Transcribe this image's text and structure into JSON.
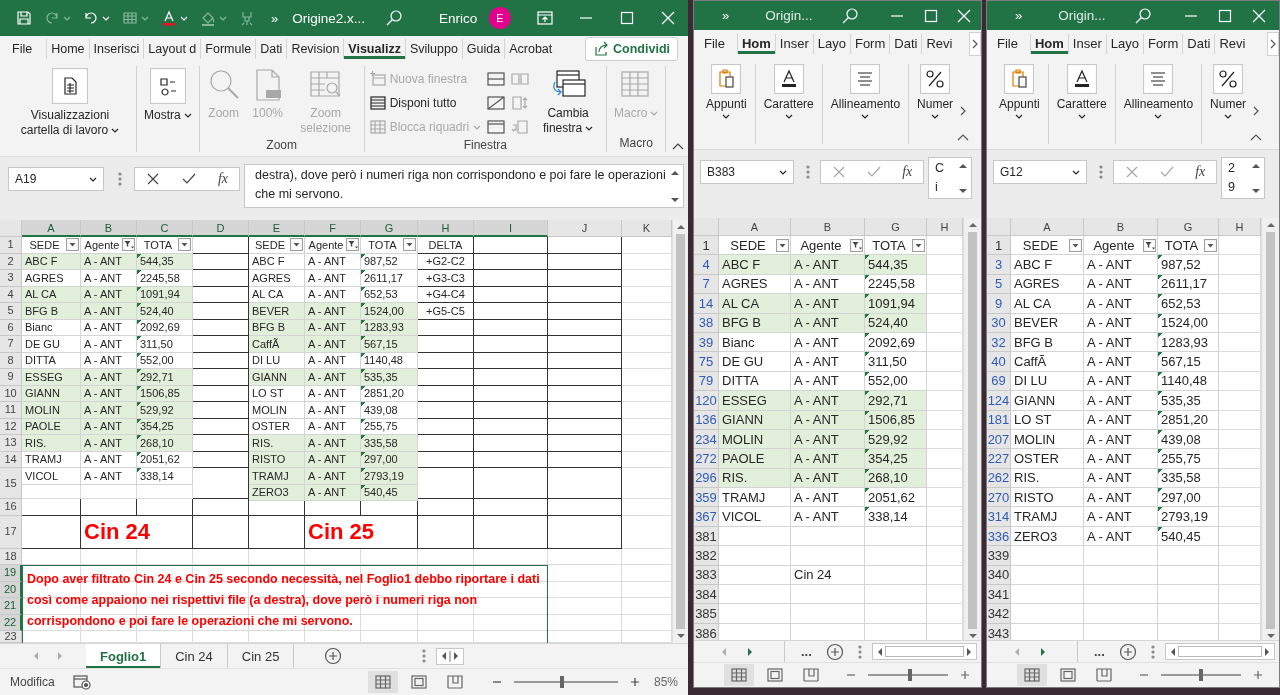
{
  "main_window": {
    "quick_access": [
      {
        "kind": "save",
        "disabled": false
      },
      {
        "kind": "redo",
        "disabled": true,
        "dropdown": true
      },
      {
        "kind": "undo",
        "disabled": false,
        "dropdown": true
      },
      {
        "kind": "table",
        "disabled": true,
        "dropdown": true
      },
      {
        "kind": "font-color",
        "disabled": false,
        "dropdown": true
      },
      {
        "kind": "fill",
        "disabled": true,
        "dropdown": true
      },
      {
        "kind": "clear",
        "disabled": true
      }
    ],
    "overflow": "»",
    "title": "Origine2.x...",
    "user": "Enrico",
    "avatar": "E",
    "tabs": [
      {
        "label": "File",
        "selected": false
      },
      {
        "label": "Home",
        "selected": false
      },
      {
        "label": "Inserisci",
        "selected": false
      },
      {
        "label": "Layout d",
        "selected": false
      },
      {
        "label": "Formule",
        "selected": false
      },
      {
        "label": "Dati",
        "selected": false
      },
      {
        "label": "Revision",
        "selected": false
      },
      {
        "label": "Visualizz",
        "selected": true
      },
      {
        "label": "Sviluppo",
        "selected": false
      },
      {
        "label": "Guida",
        "selected": false
      },
      {
        "label": "Acrobat",
        "selected": false
      }
    ],
    "share_button": "Condividi",
    "ribbon_groups": [
      {
        "commands": [
          {
            "label": "Visualizzazioni cartella di lavoro",
            "kind": "large",
            "disabled": false,
            "dropdown": true
          }
        ]
      },
      {
        "commands": [
          {
            "label": "Mostra",
            "kind": "large",
            "disabled": false,
            "dropdown": true
          }
        ]
      },
      {
        "label": "Zoom",
        "commands": [
          {
            "label": "Zoom",
            "kind": "large",
            "disabled": true,
            "dropdown": false
          },
          {
            "label": "100%",
            "kind": "large",
            "disabled": true,
            "dropdown": false
          },
          {
            "label": "Zoom selezione",
            "kind": "large",
            "disabled": true,
            "dropdown": false
          }
        ]
      },
      {
        "label": "Finestra",
        "commands": [
          {
            "label": "Nuova finestra",
            "kind": "small",
            "disabled": true,
            "dropdown": false
          },
          {
            "label": "Disponi tutto",
            "kind": "small",
            "disabled": false,
            "dropdown": false
          },
          {
            "label": "Blocca riquadri",
            "kind": "small",
            "disabled": true,
            "dropdown": true
          },
          {
            "kind": "icon",
            "disabled": false
          },
          {
            "kind": "icon",
            "disabled": false
          },
          {
            "kind": "icon",
            "disabled": false
          },
          {
            "kind": "icon",
            "disabled": true
          },
          {
            "kind": "icon",
            "disabled": true
          },
          {
            "kind": "icon",
            "disabled": true
          },
          {
            "label": "Cambia finestra",
            "kind": "large",
            "disabled": false,
            "dropdown": true
          }
        ]
      },
      {
        "label": "Macro",
        "commands": [
          {
            "label": "Macro",
            "kind": "large",
            "disabled": true,
            "dropdown": true
          }
        ]
      }
    ],
    "name_box": "A19",
    "fx": "fx",
    "formula": "destra), dove però i numeri riga non corrispondono e poi fare le operazioni che mi servono.",
    "sheet": {
      "columns": [
        {
          "label": "A",
          "selected": true
        },
        {
          "label": "B",
          "selected": true
        },
        {
          "label": "C",
          "selected": true
        },
        {
          "label": "D",
          "selected": true
        },
        {
          "label": "E",
          "selected": true
        },
        {
          "label": "F",
          "selected": true
        },
        {
          "label": "G",
          "selected": true
        },
        {
          "label": "H",
          "selected": true
        },
        {
          "label": "I",
          "selected": true
        },
        {
          "label": "J",
          "selected": false
        },
        {
          "label": "K",
          "selected": false
        }
      ],
      "rows": [
        {
          "label": "1",
          "selected": false
        },
        {
          "label": "2",
          "selected": false
        },
        {
          "label": "3",
          "selected": false
        },
        {
          "label": "4",
          "selected": false
        },
        {
          "label": "5",
          "selected": false
        },
        {
          "label": "6",
          "selected": false
        },
        {
          "label": "7",
          "selected": false
        },
        {
          "label": "8",
          "selected": false
        },
        {
          "label": "9",
          "selected": false
        },
        {
          "label": "10",
          "selected": false
        },
        {
          "label": "11",
          "selected": false
        },
        {
          "label": "12",
          "selected": false
        },
        {
          "label": "13",
          "selected": false
        },
        {
          "label": "14",
          "selected": false
        },
        {
          "label": "15",
          "selected": false
        },
        {
          "label": "16",
          "selected": false
        },
        {
          "label": "17",
          "selected": false
        },
        {
          "label": "18",
          "selected": false
        },
        {
          "label": "19",
          "selected": true
        },
        {
          "label": "20",
          "selected": true
        },
        {
          "label": "21",
          "selected": true
        },
        {
          "label": "22",
          "selected": true
        },
        {
          "label": "23",
          "selected": false
        }
      ],
      "blocks": [
        {
          "header": [
            {
              "label": "SEDE",
              "filtered": false
            },
            {
              "label": "Agente",
              "filtered": true
            },
            {
              "label": "TOTA",
              "filtered": false
            }
          ],
          "rows": [
            {
              "cells": [
                "ABC F",
                "A - ANT",
                "544,35"
              ],
              "highlighted": true
            },
            {
              "cells": [
                "AGRES",
                "A - ANT",
                "2245,58"
              ],
              "highlighted": false
            },
            {
              "cells": [
                "AL CA",
                "A - ANT",
                "1091,94"
              ],
              "highlighted": true
            },
            {
              "cells": [
                "BFG B",
                "A - ANT",
                "524,40"
              ],
              "highlighted": true
            },
            {
              "cells": [
                "Bianc",
                "A - ANT",
                "2092,69"
              ],
              "highlighted": false
            },
            {
              "cells": [
                "DE GU",
                "A - ANT",
                "311,50"
              ],
              "highlighted": false
            },
            {
              "cells": [
                "DITTA",
                "A - ANT",
                "552,00"
              ],
              "highlighted": false
            },
            {
              "cells": [
                "ESSEG",
                "A - ANT",
                "292,71"
              ],
              "highlighted": true
            },
            {
              "cells": [
                "GIANN",
                "A - ANT",
                "1506,85"
              ],
              "highlighted": true
            },
            {
              "cells": [
                "MOLIN",
                "A - ANT",
                "529,92"
              ],
              "highlighted": true
            },
            {
              "cells": [
                "PAOLE",
                "A - ANT",
                "354,25"
              ],
              "highlighted": true
            },
            {
              "cells": [
                "RIS.",
                "A - ANT",
                "268,10"
              ],
              "highlighted": true
            },
            {
              "cells": [
                "TRAMJ",
                "A - ANT",
                "2051,62"
              ],
              "highlighted": false
            },
            {
              "cells": [
                "VICOL",
                "A - ANT",
                "338,14"
              ],
              "highlighted": false
            }
          ]
        },
        {
          "header": [
            {
              "label": "SEDE",
              "filtered": false
            },
            {
              "label": "Agente",
              "filtered": true
            },
            {
              "label": "TOTA",
              "filtered": false
            }
          ],
          "rows": [
            {
              "cells": [
                "ABC F",
                "A - ANT",
                "987,52"
              ],
              "highlighted": false
            },
            {
              "cells": [
                "AGRES",
                "A - ANT",
                "2611,17"
              ],
              "highlighted": false
            },
            {
              "cells": [
                "AL CA",
                "A - ANT",
                "652,53"
              ],
              "highlighted": false
            },
            {
              "cells": [
                "BEVER",
                "A - ANT",
                "1524,00"
              ],
              "highlighted": true
            },
            {
              "cells": [
                "BFG B",
                "A - ANT",
                "1283,93"
              ],
              "highlighted": true
            },
            {
              "cells": [
                "CaffÃ",
                "A - ANT",
                "567,15"
              ],
              "highlighted": true
            },
            {
              "cells": [
                "DI LU",
                "A - ANT",
                "1140,48"
              ],
              "highlighted": false
            },
            {
              "cells": [
                "GIANN",
                "A - ANT",
                "535,35"
              ],
              "highlighted": true
            },
            {
              "cells": [
                "LO ST",
                "A - ANT",
                "2851,20"
              ],
              "highlighted": false
            },
            {
              "cells": [
                "MOLIN",
                "A - ANT",
                "439,08"
              ],
              "highlighted": false
            },
            {
              "cells": [
                "OSTER",
                "A - ANT",
                "255,75"
              ],
              "highlighted": false
            },
            {
              "cells": [
                "RIS.",
                "A - ANT",
                "335,58"
              ],
              "highlighted": true
            },
            {
              "cells": [
                "RISTO",
                "A - ANT",
                "297,00"
              ],
              "highlighted": true
            },
            {
              "cells": [
                "TRAMJ",
                "A - ANT",
                "2793,19"
              ],
              "highlighted": true
            },
            {
              "cells": [
                "ZERO3",
                "A - ANT",
                "540,45"
              ],
              "highlighted": true
            }
          ]
        }
      ],
      "delta": {
        "header": "DELTA",
        "formulas": [
          "+G2-C2",
          "+G3-C3",
          "+G4-C4",
          "+G5-C5"
        ]
      },
      "captions": [
        "Cin 24",
        "Cin 25"
      ],
      "note": "Dopo aver filtrato Cin 24 e Cin 25 secondo necessità, nel Foglio1 debbo riportare i dati così come appaiono nei rispettivi file (a destra), dove però i numeri riga non corrispondono e poi fare le operazioni che mi servono."
    },
    "sheet_tabs": [
      {
        "label": "Foglio1",
        "selected": true
      },
      {
        "label": "Cin 24",
        "selected": false
      },
      {
        "label": "Cin 25",
        "selected": false
      }
    ],
    "status": "Modifica",
    "zoom_slider": {
      "level": 0.46
    },
    "zoom": "85%"
  },
  "side_windows": [
    {
      "overflow": "»",
      "title": "Origin...",
      "tabs": [
        {
          "label": "File",
          "selected": false
        },
        {
          "label": "Hom",
          "selected": true
        },
        {
          "label": "Inser",
          "selected": false
        },
        {
          "label": "Layo",
          "selected": false
        },
        {
          "label": "Form",
          "selected": false
        },
        {
          "label": "Dati",
          "selected": false
        },
        {
          "label": "Revi",
          "selected": false
        }
      ],
      "ribbon_groups": [
        "Appunti",
        "Carattere",
        "Allineamento",
        "Numer"
      ],
      "name_box": "B383",
      "fx": "fx",
      "formula_lines": [
        "C",
        "i"
      ],
      "columns": [
        "A",
        "B",
        "G",
        "H"
      ],
      "header_row": "1",
      "header": [
        {
          "label": "SEDE",
          "filtered": false
        },
        {
          "label": "Agente",
          "filtered": true
        },
        {
          "label": "TOTA",
          "filtered": false
        }
      ],
      "rows": [
        {
          "number": "4",
          "filtered": true,
          "highlighted": true,
          "cells": {
            "A": "ABC F",
            "B": "A - ANT",
            "G": "544,35"
          }
        },
        {
          "number": "7",
          "filtered": true,
          "highlighted": false,
          "cells": {
            "A": "AGRES",
            "B": "A - ANT",
            "G": "2245,58"
          }
        },
        {
          "number": "14",
          "filtered": true,
          "highlighted": true,
          "cells": {
            "A": "AL CA",
            "B": "A - ANT",
            "G": "1091,94"
          }
        },
        {
          "number": "38",
          "filtered": true,
          "highlighted": true,
          "cells": {
            "A": "BFG B",
            "B": "A - ANT",
            "G": "524,40"
          }
        },
        {
          "number": "39",
          "filtered": true,
          "highlighted": false,
          "cells": {
            "A": "Bianc",
            "B": "A - ANT",
            "G": "2092,69"
          }
        },
        {
          "number": "75",
          "filtered": true,
          "highlighted": false,
          "cells": {
            "A": "DE GU",
            "B": "A - ANT",
            "G": "311,50"
          }
        },
        {
          "number": "79",
          "filtered": true,
          "highlighted": false,
          "cells": {
            "A": "DITTA",
            "B": "A - ANT",
            "G": "552,00"
          }
        },
        {
          "number": "120",
          "filtered": true,
          "highlighted": true,
          "cells": {
            "A": "ESSEG",
            "B": "A - ANT",
            "G": "292,71"
          }
        },
        {
          "number": "136",
          "filtered": true,
          "highlighted": true,
          "cells": {
            "A": "GIANN",
            "B": "A - ANT",
            "G": "1506,85"
          }
        },
        {
          "number": "234",
          "filtered": true,
          "highlighted": true,
          "cells": {
            "A": "MOLIN",
            "B": "A - ANT",
            "G": "529,92"
          }
        },
        {
          "number": "272",
          "filtered": true,
          "highlighted": true,
          "cells": {
            "A": "PAOLE",
            "B": "A - ANT",
            "G": "354,25"
          }
        },
        {
          "number": "296",
          "filtered": true,
          "highlighted": true,
          "cells": {
            "A": "RIS.",
            "B": "A - ANT",
            "G": "268,10"
          }
        },
        {
          "number": "359",
          "filtered": true,
          "highlighted": false,
          "cells": {
            "A": "TRAMJ",
            "B": "A - ANT",
            "G": "2051,62"
          }
        },
        {
          "number": "367",
          "filtered": true,
          "highlighted": false,
          "cells": {
            "A": "VICOL",
            "B": "A - ANT",
            "G": "338,14"
          }
        },
        {
          "number": "381",
          "filtered": false,
          "highlighted": false
        },
        {
          "number": "382",
          "filtered": false,
          "highlighted": false
        },
        {
          "number": "383",
          "filtered": false,
          "highlighted": false,
          "cells": {
            "B": "Cin 24"
          }
        },
        {
          "number": "384",
          "filtered": false,
          "highlighted": false
        },
        {
          "number": "385",
          "filtered": false,
          "highlighted": false
        },
        {
          "number": "386",
          "filtered": false,
          "highlighted": false
        }
      ],
      "more_tabs": "...",
      "zoom_slider": {
        "level": 0.52
      }
    },
    {
      "overflow": "»",
      "title": "Origin...",
      "tabs": [
        {
          "label": "File",
          "selected": false
        },
        {
          "label": "Hom",
          "selected": true
        },
        {
          "label": "Inser",
          "selected": false
        },
        {
          "label": "Layo",
          "selected": false
        },
        {
          "label": "Form",
          "selected": false
        },
        {
          "label": "Dati",
          "selected": false
        },
        {
          "label": "Revi",
          "selected": false
        }
      ],
      "ribbon_groups": [
        "Appunti",
        "Carattere",
        "Allineamento",
        "Numer"
      ],
      "name_box": "G12",
      "fx": "fx",
      "formula_lines": [
        "2",
        "9"
      ],
      "columns": [
        "A",
        "B",
        "G",
        "H"
      ],
      "header_row": "1",
      "header": [
        {
          "label": "SEDE",
          "filtered": false
        },
        {
          "label": "Agente",
          "filtered": true
        },
        {
          "label": "TOTA",
          "filtered": false
        }
      ],
      "rows": [
        {
          "number": "3",
          "filtered": true,
          "highlighted": false,
          "cells": {
            "A": "ABC F",
            "B": "A - ANT",
            "G": "987,52"
          }
        },
        {
          "number": "5",
          "filtered": true,
          "highlighted": false,
          "cells": {
            "A": "AGRES",
            "B": "A - ANT",
            "G": "2611,17"
          }
        },
        {
          "number": "9",
          "filtered": true,
          "highlighted": false,
          "cells": {
            "A": "AL CA",
            "B": "A - ANT",
            "G": "652,53"
          }
        },
        {
          "number": "30",
          "filtered": true,
          "highlighted": false,
          "cells": {
            "A": "BEVER",
            "B": "A - ANT",
            "G": "1524,00"
          }
        },
        {
          "number": "32",
          "filtered": true,
          "highlighted": false,
          "cells": {
            "A": "BFG B",
            "B": "A - ANT",
            "G": "1283,93"
          }
        },
        {
          "number": "40",
          "filtered": true,
          "highlighted": false,
          "cells": {
            "A": "CaffÃ",
            "B": "A - ANT",
            "G": "567,15"
          }
        },
        {
          "number": "69",
          "filtered": true,
          "highlighted": false,
          "cells": {
            "A": "DI LU",
            "B": "A - ANT",
            "G": "1140,48"
          }
        },
        {
          "number": "124",
          "filtered": true,
          "highlighted": false,
          "cells": {
            "A": "GIANN",
            "B": "A - ANT",
            "G": "535,35"
          }
        },
        {
          "number": "181",
          "filtered": true,
          "highlighted": false,
          "cells": {
            "A": "LO ST",
            "B": "A - ANT",
            "G": "2851,20"
          }
        },
        {
          "number": "207",
          "filtered": true,
          "highlighted": false,
          "cells": {
            "A": "MOLIN",
            "B": "A - ANT",
            "G": "439,08"
          }
        },
        {
          "number": "227",
          "filtered": true,
          "highlighted": false,
          "cells": {
            "A": "OSTER",
            "B": "A - ANT",
            "G": "255,75"
          }
        },
        {
          "number": "262",
          "filtered": true,
          "highlighted": false,
          "cells": {
            "A": "RIS.",
            "B": "A - ANT",
            "G": "335,58"
          }
        },
        {
          "number": "270",
          "filtered": true,
          "highlighted": false,
          "cells": {
            "A": "RISTO",
            "B": "A - ANT",
            "G": "297,00"
          }
        },
        {
          "number": "314",
          "filtered": true,
          "highlighted": false,
          "cells": {
            "A": "TRAMJ",
            "B": "A - ANT",
            "G": "2793,19"
          }
        },
        {
          "number": "336",
          "filtered": true,
          "highlighted": false,
          "cells": {
            "A": "ZERO3",
            "B": "A - ANT",
            "G": "540,45"
          }
        },
        {
          "number": "339",
          "filtered": false,
          "highlighted": false
        },
        {
          "number": "340",
          "filtered": false,
          "highlighted": false
        },
        {
          "number": "341",
          "filtered": false,
          "highlighted": false
        },
        {
          "number": "342",
          "filtered": false,
          "highlighted": false
        },
        {
          "number": "343",
          "filtered": false,
          "highlighted": false
        }
      ],
      "more_tabs": "...",
      "zoom_slider": {
        "level": 0.5
      }
    }
  ]
}
